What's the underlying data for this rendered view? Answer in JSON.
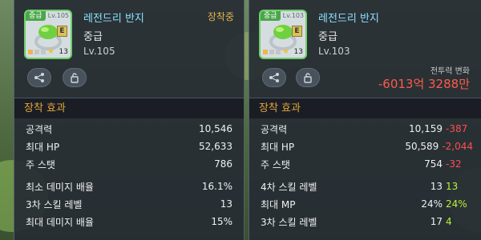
{
  "colors": {
    "panel_bg": "#262c34",
    "name": "#8ee0ff",
    "equipped": "#e3b24d",
    "section": "#e3a53c",
    "negative": "#ff4d4d",
    "positive": "#b9f23c"
  },
  "left": {
    "icon": {
      "grade_tag": "중급",
      "level_tag": "Lv.105",
      "badge": "E",
      "stars": "13",
      "art": "green-ring-icon"
    },
    "name": "레전드리 반지",
    "grade": "중급",
    "level": "Lv.105",
    "equipped": "장착중",
    "section_title": "장착 효과",
    "stats": [
      {
        "label": "공격력",
        "value": "10,546"
      },
      {
        "label": "최대 HP",
        "value": "52,633"
      },
      {
        "label": "주 스탯",
        "value": "786"
      }
    ],
    "extra": [
      {
        "label": "최소 데미지 배율",
        "value": "16.1%"
      },
      {
        "label": "3차 스킬 레벨",
        "value": "13"
      },
      {
        "label": "최대 데미지 배율",
        "value": "15%"
      }
    ]
  },
  "right": {
    "icon": {
      "grade_tag": "중급",
      "level_tag": "Lv.103",
      "badge": "E",
      "stars": "13",
      "art": "green-ring-icon"
    },
    "name": "레전드리 반지",
    "grade": "중급",
    "level": "Lv.103",
    "cp_label": "전투력 변화",
    "cp_value": "-6013억 3288만",
    "section_title": "장착 효과",
    "stats": [
      {
        "label": "공격력",
        "value": "10,159",
        "diff": "-387"
      },
      {
        "label": "최대 HP",
        "value": "50,589",
        "diff": "-2,044"
      },
      {
        "label": "주 스탯",
        "value": "754",
        "diff": "-32"
      }
    ],
    "extra": [
      {
        "label": "4차 스킬 레벨",
        "value": "13",
        "diff": "13"
      },
      {
        "label": "최대 MP",
        "value": "24%",
        "diff": "24%"
      },
      {
        "label": "3차 스킬 레벨",
        "value": "17",
        "diff": "4"
      }
    ]
  }
}
